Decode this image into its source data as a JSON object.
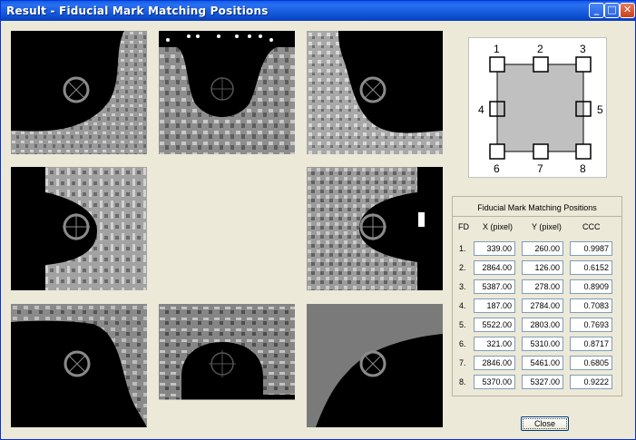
{
  "window": {
    "title": "Result - Fiducial Mark Matching Positions",
    "buttons": {
      "minimize": "_",
      "maximize": "□",
      "close": "✕"
    }
  },
  "tiles": [
    {
      "id": 1,
      "shape": "tl"
    },
    {
      "id": 2,
      "shape": "t"
    },
    {
      "id": 3,
      "shape": "tr"
    },
    {
      "id": 4,
      "shape": "l"
    },
    {
      "id": 5,
      "shape": "r"
    },
    {
      "id": 6,
      "shape": "bl"
    },
    {
      "id": 7,
      "shape": "b"
    },
    {
      "id": 8,
      "shape": "br"
    }
  ],
  "layout_diagram": {
    "labels": [
      "1",
      "2",
      "3",
      "4",
      "5",
      "6",
      "7",
      "8"
    ]
  },
  "results": {
    "title": "Fiducial Mark Matching Positions",
    "headers": {
      "fd": "FD",
      "x": "X (pixel)",
      "y": "Y (pixel)",
      "ccc": "CCC"
    },
    "rows": [
      {
        "fd": "1.",
        "x": "339.00",
        "y": "260.00",
        "ccc": "0.9987"
      },
      {
        "fd": "2.",
        "x": "2864.00",
        "y": "126.00",
        "ccc": "0.6152"
      },
      {
        "fd": "3.",
        "x": "5387.00",
        "y": "278.00",
        "ccc": "0.8909"
      },
      {
        "fd": "4.",
        "x": "187.00",
        "y": "2784.00",
        "ccc": "0.7083"
      },
      {
        "fd": "5.",
        "x": "5522.00",
        "y": "2803.00",
        "ccc": "0.7693"
      },
      {
        "fd": "6.",
        "x": "321.00",
        "y": "5310.00",
        "ccc": "0.8717"
      },
      {
        "fd": "7.",
        "x": "2846.00",
        "y": "5461.00",
        "ccc": "0.6805"
      },
      {
        "fd": "8.",
        "x": "5370.00",
        "y": "5327.00",
        "ccc": "0.9222"
      }
    ]
  },
  "close_button": {
    "label": "Close"
  }
}
